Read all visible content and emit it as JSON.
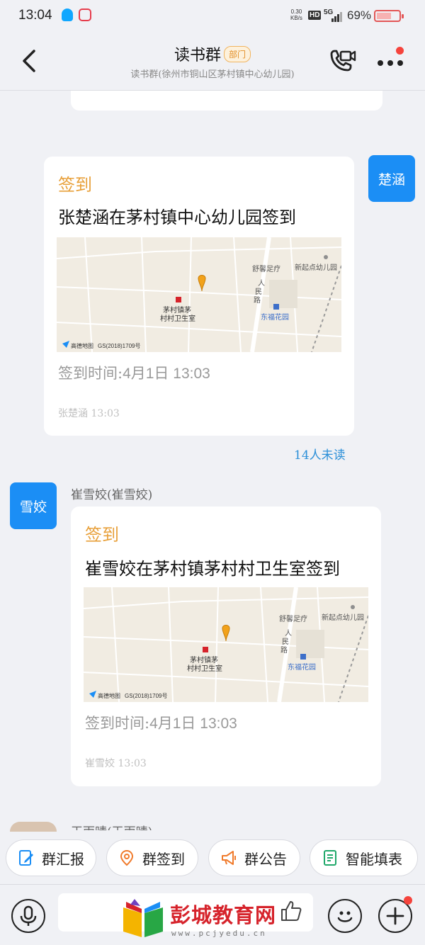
{
  "status_bar": {
    "time": "13:04",
    "net_speed_value": "0.30",
    "net_speed_unit": "KB/s",
    "hd": "HD",
    "network": "5G",
    "battery_pct": "69%"
  },
  "header": {
    "title": "读书群",
    "tag": "部门",
    "subtitle": "读书群(徐州市铜山区茅村镇中心幼儿园)"
  },
  "messages": [
    {
      "avatar_label": "楚涵",
      "label": "签到",
      "text": "张楚涵在茅村镇中心幼儿园签到",
      "time_label": "签到时间:",
      "time_value": "4月1日 13:03",
      "footer": "张楚涵 13:03",
      "unread": "14人未读",
      "map": {
        "poi_clinic": [
          "茅村镇茅",
          "村村卫生室"
        ],
        "poi_foot": "舒馨足疗",
        "poi_kinder": "新起点幼儿园",
        "road": [
          "人",
          "民",
          "路"
        ],
        "poi_garden": "东福花园",
        "brand": "高德地图",
        "license": "GS(2018)1709号"
      }
    },
    {
      "avatar_label": "雪姣",
      "sender": "崔雪姣(崔雪姣)",
      "label": "签到",
      "text": "崔雪姣在茅村镇茅村村卫生室签到",
      "time_label": "签到时间:",
      "time_value": "4月1日 13:03",
      "footer": "崔雪姣 13:03",
      "map": {
        "poi_clinic": [
          "茅村镇茅",
          "村村卫生室"
        ],
        "poi_foot": "舒馨足疗",
        "poi_kinder": "新起点幼儿园",
        "road": [
          "人",
          "民",
          "路"
        ],
        "poi_garden": "东福花园",
        "brand": "高德地图",
        "license": "GS(2018)1709号"
      }
    }
  ],
  "partial_sender": "王雨晴(王雨晴)",
  "quick_actions": [
    {
      "label": "群汇报",
      "icon": "report-icon",
      "color": "#1b8ef5"
    },
    {
      "label": "群签到",
      "icon": "location-pin-icon",
      "color": "#f07a2b"
    },
    {
      "label": "群公告",
      "icon": "megaphone-icon",
      "color": "#f07a2b"
    },
    {
      "label": "智能填表",
      "icon": "form-icon",
      "color": "#1fa86a"
    }
  ],
  "watermark": {
    "text": "彭城教育网",
    "url": "www.pcjyedu.cn"
  },
  "colors": {
    "accent_blue": "#1b8ef5",
    "label_orange": "#e8a03a",
    "unread_blue": "#2b8fd8",
    "badge_red": "#f5433c"
  }
}
